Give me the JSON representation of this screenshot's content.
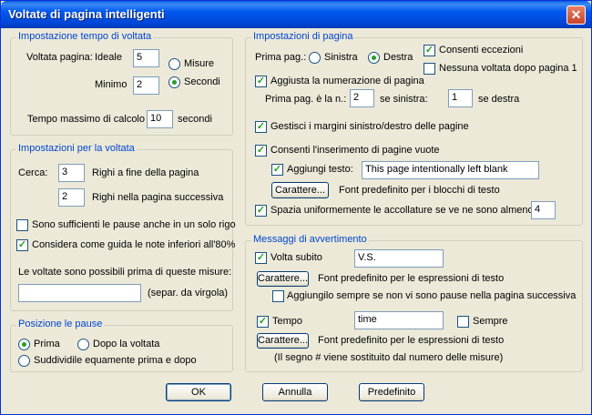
{
  "window": {
    "title": "Voltate di pagina intelligenti",
    "close_glyph": "✕"
  },
  "tempo": {
    "legend": "Impostazione tempo di voltata",
    "voltata_label": "Voltata pagina:",
    "ideale_label": "Ideale",
    "ideale_value": "5",
    "minimo_label": "Minimo",
    "minimo_value": "2",
    "misure_label": "Misure",
    "secondi_label": "Secondi",
    "unit_selected": "Secondi",
    "max_label": "Tempo massimo di calcolo",
    "max_value": "10",
    "max_unit": "secondi"
  },
  "voltata": {
    "legend": "Impostazioni per la voltata",
    "cerca_label": "Cerca:",
    "cerca_value1": "3",
    "cerca_desc1": "Righi a fine della pagina",
    "cerca_value2": "2",
    "cerca_desc2": "Righi nella pagina successiva",
    "pause_label": "Sono sufficienti le pause anche in un solo rigo",
    "pause_checked": false,
    "note_label": "Considera come guida le note inferiori all'80%",
    "note_checked": true,
    "misure_text": "Le voltate sono possibili prima di queste misure:",
    "misure_value": "",
    "separ_text": "(separ. da virgola)"
  },
  "pause": {
    "legend": "Posizione le pause",
    "prima_label": "Prima",
    "dopo_label": "Dopo la voltata",
    "suddividi_label": "Suddividile equamente prima e dopo",
    "selected": "Prima"
  },
  "pagina": {
    "legend": "Impostazioni di pagina",
    "prima_pag_label": "Prima pag.:",
    "sinistra_label": "Sinistra",
    "destra_label": "Destra",
    "selected": "Destra",
    "eccezioni_label": "Consenti eccezioni",
    "eccezioni_checked": true,
    "nessuna_label": "Nessuna voltata dopo pagina 1",
    "nessuna_checked": false,
    "aggiusta_label": "Aggiusta la numerazione di pagina",
    "aggiusta_checked": true,
    "prima_pag_n_label": "Prima pag. è la n.:",
    "prima_pag_n_value": "2",
    "se_sinistra_label": "se sinistra:",
    "se_sinistra_value": "1",
    "se_destra_label": "se destra",
    "margini_label": "Gestisci i margini sinistro/destro delle pagine",
    "margini_checked": true,
    "vuote_label": "Consenti l'inserimento di pagine vuote",
    "vuote_checked": true,
    "aggiungi_label": "Aggiungi testo:",
    "aggiungi_checked": true,
    "aggiungi_value": "This page intentionally left blank",
    "carattere_button": "Carattere...",
    "font_desc": "Font predefinito per i blocchi di testo",
    "spazia_label": "Spazia uniformemente le accollature se ve ne sono almeno",
    "spazia_checked": true,
    "spazia_value": "4"
  },
  "messaggi": {
    "legend": "Messaggi di avvertimento",
    "volta_label": "Volta subito",
    "volta_checked": true,
    "volta_value": "V.S.",
    "carattere_button1": "Carattere...",
    "font_desc1": "Font predefinito per le espressioni di testo",
    "aggiungilo_label": "Aggiungilo sempre se non vi sono pause nella pagina successiva",
    "aggiungilo_checked": false,
    "tempo_label": "Tempo",
    "tempo_checked": true,
    "tempo_value": "time",
    "sempre_label": "Sempre",
    "sempre_checked": false,
    "carattere_button2": "Carattere...",
    "font_desc2": "Font predefinito per le espressioni di testo",
    "note_text": "(Il segno # viene sostituito dal numero delle misure)"
  },
  "footer": {
    "ok": "OK",
    "annulla": "Annulla",
    "predefinito": "Predefinito"
  },
  "check_glyph": "✓"
}
